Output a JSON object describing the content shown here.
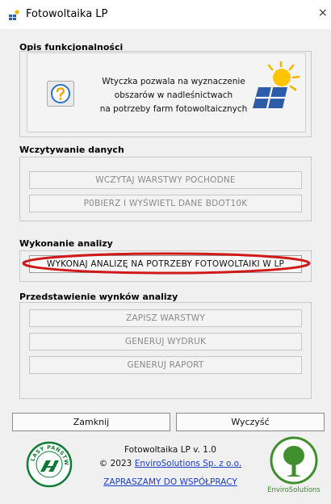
{
  "window": {
    "title": "Fotowoltaika LP",
    "close_symbol": "×"
  },
  "section_description": {
    "title": "Opis funkcjonalności",
    "description_lines": [
      "Wtyczka pozwala na wyznaczenie",
      "obszarów w nadleśnictwach",
      "na potrzeby farm fotowoltaicznych"
    ]
  },
  "section_loading": {
    "title": "Wczytywanie danych",
    "buttons": [
      "WCZYTAJ WARSTWY POCHODNE",
      "P0BIERZ I WYŚWIETL DANE BDOT10K"
    ]
  },
  "section_analysis": {
    "title": "Wykonanie analizy",
    "button": "WYKONAJ ANALIZĘ NA POTRZEBY FOTOWOLTAIKI W LP",
    "highlight_color": "#d01a1a"
  },
  "section_results": {
    "title": "Przedstawienie wynków analizy",
    "buttons": [
      "ZAPISZ WARSTWY",
      "GENERUJ WYDRUK",
      "GENERUJ RAPORT"
    ]
  },
  "footer": {
    "close_button": "Zamknij",
    "clear_button": "Wyczyść",
    "version": "Fotowoltaika LP v. 1.0",
    "copyright_prefix": "© 2023 ",
    "company_link": "EnviroSolutions Sp. z o.o.",
    "cooperation_link": "ZAPRASZAMY DO WSPÓŁPRACY",
    "enviro_logo_text": "EnviroSolutions"
  },
  "colors": {
    "link": "#1a3cc7",
    "lp_logo_green": "#0f7a35",
    "enviro_green": "#3f8f2f"
  },
  "icons": [
    "app-logo-icon",
    "help-icon",
    "solar-panel-icon",
    "lasy-panstwowe-logo",
    "envirosolutions-logo"
  ]
}
